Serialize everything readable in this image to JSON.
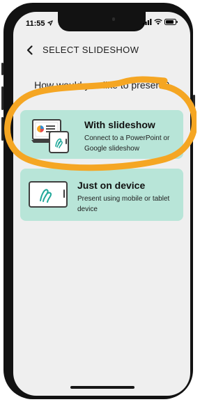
{
  "status_bar": {
    "time": "11:55",
    "icons": [
      "location-arrow-icon",
      "signal-icon",
      "wifi-icon",
      "battery-icon"
    ]
  },
  "header": {
    "back_icon": "chevron-left-icon",
    "title": "SELECT SLIDESHOW"
  },
  "question": "How would you like to present?",
  "options": [
    {
      "title": "With slideshow",
      "description": "Connect to a PowerPoint or Google slideshow",
      "icon": "laptop-and-phone-icon"
    },
    {
      "title": "Just on device",
      "description": "Present using mobile or tablet device",
      "icon": "tablet-icon"
    }
  ],
  "annotation": {
    "color": "#f5a623",
    "highlighted_option": "With slideshow"
  },
  "colors": {
    "card_background": "#b8e5d8",
    "accent_teal": "#21a89a",
    "screen_background": "#efefef"
  }
}
